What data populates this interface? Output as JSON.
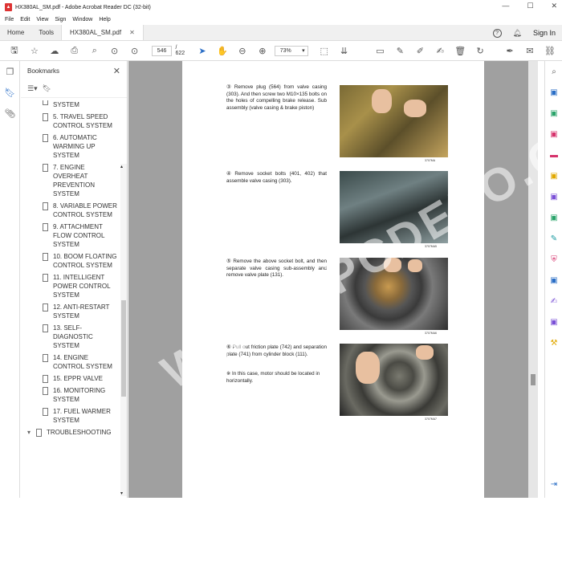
{
  "window": {
    "title": "HX380AL_SM.pdf - Adobe Acrobat Reader DC (32-bit)",
    "minimize": "—",
    "maximize": "☐",
    "close": "✕"
  },
  "menu": [
    "File",
    "Edit",
    "View",
    "Sign",
    "Window",
    "Help"
  ],
  "tabs": {
    "home": "Home",
    "tools": "Tools",
    "document": "HX380AL_SM.pdf",
    "close": "✕",
    "help": "?",
    "signin": "Sign In"
  },
  "toolbar": {
    "page_current": "546",
    "page_total": "/ 622",
    "zoom": "73%"
  },
  "bookmarks": {
    "title": "Bookmarks",
    "close": "✕",
    "items": [
      "SYSTEM",
      "5. TRAVEL SPEED CONTROL SYSTEM",
      "6. AUTOMATIC WARMING UP SYSTEM",
      "7. ENGINE OVERHEAT PREVENTION SYSTEM",
      "8. VARIABLE POWER CONTROL  SYSTEM",
      "9. ATTACHMENT FLOW CONTROL SYSTEM",
      "10. BOOM FLOATING CONTROL SYSTEM",
      "11. INTELLIGENT POWER CONTROL SYSTEM",
      "12. ANTI-RESTART SYSTEM",
      "13. SELF-DIAGNOSTIC SYSTEM",
      "14. ENGINE CONTROL SYSTEM",
      "15. EPPR VALVE",
      "16. MONITORING SYSTEM",
      "17. FUEL WARMER SYSTEM"
    ],
    "top_item": "TROUBLESHOOTING"
  },
  "page": {
    "steps": [
      {
        "num": "③",
        "text": "Remove plug (564) from valve casing (303).  And then screw two M10×135 bolts on the holes of compelling brake release.  Sub assembly (valve casing & brake piston)",
        "caption": "3707MA"
      },
      {
        "num": "④",
        "text": "Remove socket bolts (401, 402) that assemble valve casing (303).",
        "caption": "3707MA5"
      },
      {
        "num": "⑤",
        "text": "Remove the above socket bolt, and then separate valve casing sub-assembly and remove valve plate (131).",
        "caption": "3707MA6"
      },
      {
        "num": "⑥",
        "text": "Pull out friction plate (742) and separation plate (741) from cylinder block (111).",
        "caption": "3707MA7"
      }
    ],
    "note": "In this case, motor should be located in horizontally."
  },
  "watermark": "WWW.EPCDEPO.COM",
  "icons": {
    "right_tool_colors": [
      "#2a6ec6",
      "#2aa36a",
      "#d6336c",
      "#d6336c",
      "#e0a800",
      "#7a4fd6",
      "#2aa36a",
      "#1a9aa0",
      "#d6336c",
      "#2a6ec6",
      "#7a4fd6",
      "#7a4fd6",
      "#e0a800",
      "#555555"
    ]
  }
}
